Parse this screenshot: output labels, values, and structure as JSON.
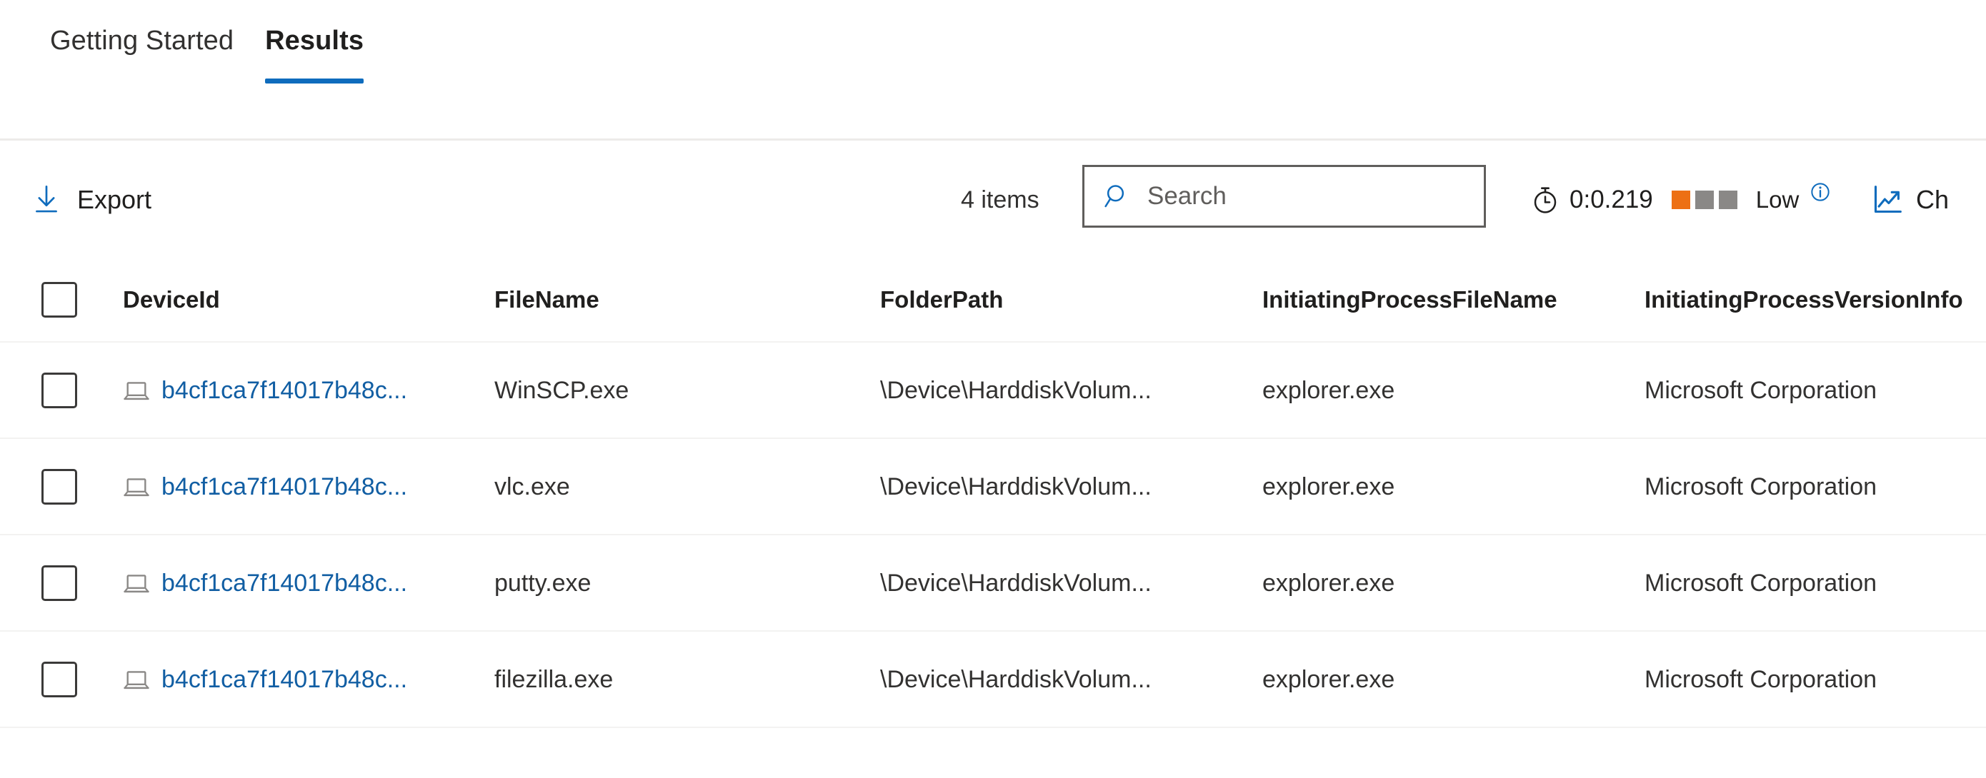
{
  "tabs": [
    {
      "label": "Getting Started",
      "active": false
    },
    {
      "label": "Results",
      "active": true
    }
  ],
  "toolbar": {
    "export_label": "Export",
    "export_icon": "download-arrow-icon",
    "items_count": "4 items",
    "search_placeholder": "Search",
    "search_value": "",
    "search_icon": "magnifier-icon",
    "timer_icon": "stopwatch-icon",
    "elapsed_time": "0:0.219",
    "resource_level": "Low",
    "resource_bars": [
      "#ed7014",
      "#8a8886",
      "#8a8886"
    ],
    "info_icon": "info-circle-icon",
    "chart_icon": "line-chart-trend-icon",
    "chart_label": "Ch"
  },
  "table": {
    "columns": [
      "DeviceId",
      "FileName",
      "FolderPath",
      "InitiatingProcessFileName",
      "InitiatingProcessVersionInfo"
    ],
    "rows": [
      {
        "device_id": "b4cf1ca7f14017b48c...",
        "file_name": "WinSCP.exe",
        "folder_path": "\\Device\\HarddiskVolum...",
        "initiating_process": "explorer.exe",
        "version_info": "Microsoft Corporation"
      },
      {
        "device_id": "b4cf1ca7f14017b48c...",
        "file_name": "vlc.exe",
        "folder_path": "\\Device\\HarddiskVolum...",
        "initiating_process": "explorer.exe",
        "version_info": "Microsoft Corporation"
      },
      {
        "device_id": "b4cf1ca7f14017b48c...",
        "file_name": "putty.exe",
        "folder_path": "\\Device\\HarddiskVolum...",
        "initiating_process": "explorer.exe",
        "version_info": "Microsoft Corporation"
      },
      {
        "device_id": "b4cf1ca7f14017b48c...",
        "file_name": "filezilla.exe",
        "folder_path": "\\Device\\HarddiskVolum...",
        "initiating_process": "explorer.exe",
        "version_info": "Microsoft Corporation"
      }
    ]
  },
  "colors": {
    "accent": "#0f6cbd",
    "link": "#115ea3",
    "warning": "#ed7014",
    "muted": "#8a8886"
  }
}
